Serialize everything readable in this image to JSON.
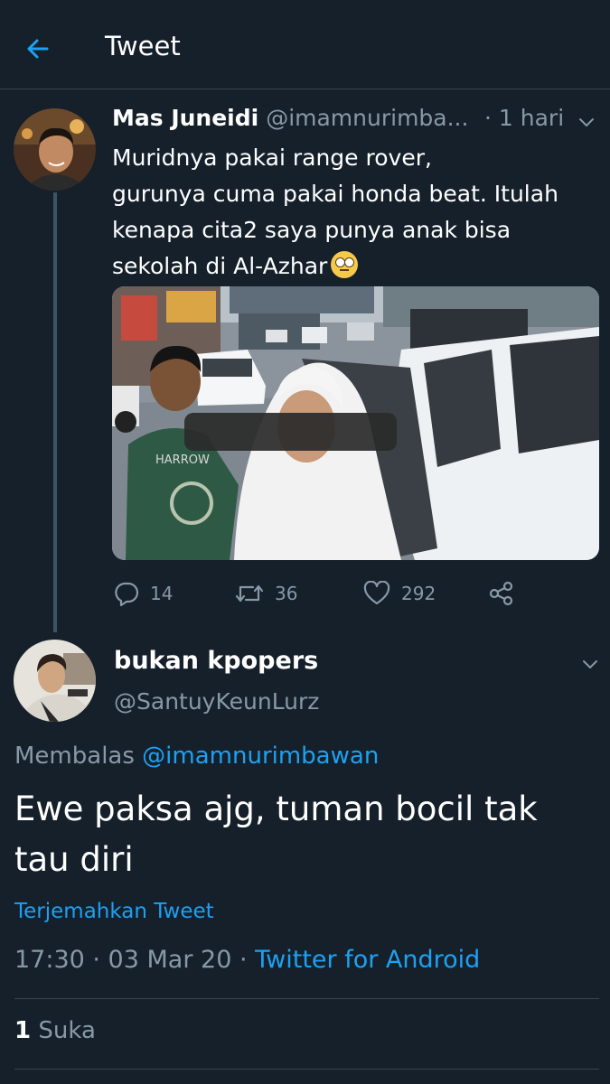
{
  "header": {
    "title": "Tweet"
  },
  "original_tweet": {
    "display_name": "Mas Juneidi",
    "handle": "@imamnurimba...",
    "time": "· 1 hari",
    "text_lines": [
      "Muridnya pakai range rover,",
      "gurunya cuma pakai honda beat. Itulah",
      "kenapa cita2 saya punya anak bisa",
      "sekolah di Al-Azhar"
    ],
    "emoji": "face-with-rolling-eyes",
    "photo_shirt_text": "HARROW",
    "counts": {
      "replies": "14",
      "retweets": "36",
      "likes": "292"
    }
  },
  "reply_tweet": {
    "display_name": "bukan kpopers",
    "handle": "@SantuyKeunLurz",
    "replying_prefix": "Membalas",
    "replying_to": "@imamnurimbawan",
    "text": "Ewe paksa ajg, tuman bocil tak tau diri",
    "translate": "Terjemahkan Tweet",
    "timestamp": "17:30 · 03 Mar 20 ·",
    "source": "Twitter for Android",
    "likes_count": "1",
    "likes_label": "Suka"
  },
  "colors": {
    "background": "#15202b",
    "accent": "#1da1f2",
    "secondary_text": "#8899a6",
    "divider": "#38444d"
  }
}
